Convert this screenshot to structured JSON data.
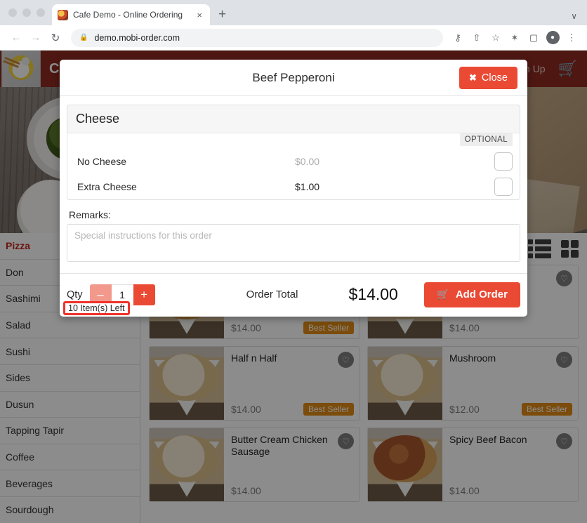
{
  "browser": {
    "tab": {
      "title": "Cafe Demo - Online Ordering",
      "close_label": "×",
      "favicon": "cafe-favicon"
    },
    "new_tab_label": "+",
    "caret_label": "∨",
    "nav": {
      "back": "←",
      "forward": "→",
      "reload": "↻"
    },
    "omnibox": {
      "url": "demo.mobi-order.com",
      "lock": "🔒"
    },
    "actions": {
      "key": "⚷",
      "share": "⇧",
      "bookmark": "☆",
      "extensions": "✶",
      "sidepanel": "▢",
      "profile": "●",
      "menu": "⋮"
    }
  },
  "site_header": {
    "brand": "Cafe Demo",
    "sign_up": "Sign Up",
    "cart_icon": "🛒"
  },
  "sidebar": {
    "items": [
      {
        "label": "Pizza",
        "active": true
      },
      {
        "label": "Don",
        "active": false
      },
      {
        "label": "Sashimi",
        "active": false
      },
      {
        "label": "Salad",
        "active": false
      },
      {
        "label": "Sushi",
        "active": false
      },
      {
        "label": "Sides",
        "active": false
      },
      {
        "label": "Dusun",
        "active": false
      },
      {
        "label": "Tapping Tapir",
        "active": false
      },
      {
        "label": "Coffee",
        "active": false
      },
      {
        "label": "Beverages",
        "active": false
      },
      {
        "label": "Sourdough",
        "active": false
      }
    ]
  },
  "toolbar": {
    "list_view_icon": "list-view-icon",
    "grid_view_icon": "grid-view-icon"
  },
  "products": [
    {
      "name": "",
      "price": "$14.00",
      "badge": "Best Seller",
      "heart": "♡",
      "style": "pep"
    },
    {
      "name": "",
      "price": "$14.00",
      "badge": "",
      "heart": "♡",
      "style": "white"
    },
    {
      "name": "Half n Half",
      "price": "$14.00",
      "badge": "Best Seller",
      "heart": "♡",
      "style": "white"
    },
    {
      "name": "Mushroom",
      "price": "$12.00",
      "badge": "Best Seller",
      "heart": "♡",
      "style": "white"
    },
    {
      "name": "Butter Cream Chicken Sausage",
      "price": "$14.00",
      "badge": "",
      "heart": "♡",
      "style": "white"
    },
    {
      "name": "Spicy Beef Bacon",
      "price": "$14.00",
      "badge": "",
      "heart": "♡",
      "style": "bacon"
    }
  ],
  "modal": {
    "title": "Beef Pepperoni",
    "close_label": "Close",
    "close_icon": "✖",
    "option_group": {
      "title": "Cheese",
      "optional_badge": "OPTIONAL",
      "options": [
        {
          "name": "No Cheese",
          "price": "$0.00",
          "paid": false
        },
        {
          "name": "Extra Cheese",
          "price": "$1.00",
          "paid": true
        }
      ]
    },
    "remarks_label": "Remarks:",
    "remarks_placeholder": "Special instructions for this order",
    "remarks_value": "",
    "qty_label": "Qty",
    "qty_minus": "–",
    "qty_value": "1",
    "qty_plus": "+",
    "items_left": "10 Item(s) Left",
    "order_total_label": "Order Total",
    "order_total_value": "$14.00",
    "add_order_label": "Add Order",
    "add_order_icon": "🛒"
  },
  "colors": {
    "brand_red": "#8e2b22",
    "accent_red": "#ea4a34",
    "highlight_red": "#f0332a",
    "badge_orange": "#e08a14",
    "active_category": "#c6261d"
  }
}
